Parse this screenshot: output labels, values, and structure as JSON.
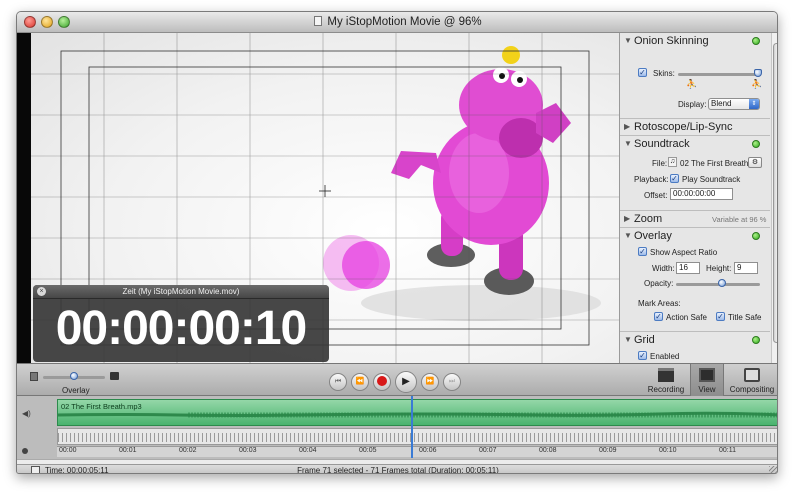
{
  "window": {
    "title": "My iStopMotion Movie @ 96%"
  },
  "sidebar": {
    "onion_skinning": {
      "title": "Onion Skinning",
      "skins_label": "Skins:",
      "display_label": "Display:",
      "display_value": "Blend"
    },
    "rotoscope": {
      "title": "Rotoscope/Lip-Sync"
    },
    "soundtrack": {
      "title": "Soundtrack",
      "file_label": "File:",
      "file_value": "02 The First Breath...",
      "playback_label": "Playback:",
      "play_soundtrack": "Play Soundtrack",
      "offset_label": "Offset:",
      "offset_value": "00:00:00:00"
    },
    "zoom": {
      "title": "Zoom",
      "value": "Variable at 96 %"
    },
    "overlay": {
      "title": "Overlay",
      "show_aspect_ratio": "Show Aspect Ratio",
      "width_label": "Width:",
      "width_value": "16",
      "height_label": "Height:",
      "height_value": "9",
      "opacity_label": "Opacity:",
      "opacity_level": 0.55,
      "mark_areas_label": "Mark Areas:",
      "action_safe": "Action Safe",
      "title_safe": "Title Safe"
    },
    "grid": {
      "title": "Grid",
      "enabled": "Enabled"
    }
  },
  "timer_panel": {
    "title": "Zeit (My iStopMotion Movie.mov)",
    "timecode": "00:00:00:10"
  },
  "toolbar": {
    "overlay_label": "Overlay",
    "overlay_level": 0.5,
    "modes": [
      {
        "label": "Recording",
        "icon": "clapperboard-icon"
      },
      {
        "label": "View",
        "icon": "view-icon"
      },
      {
        "label": "Compositing",
        "icon": "layers-icon"
      }
    ]
  },
  "timeline": {
    "audio_track": "02 The First Breath.mp3",
    "ruler": [
      "00:00",
      "00:01",
      "00:02",
      "00:03",
      "00:04",
      "00:05",
      "00:06",
      "00:07",
      "00:08",
      "00:09",
      "00:10",
      "00:11"
    ],
    "playhead_fraction": 0.49
  },
  "status": {
    "time": "Time: 00:00:05:11",
    "selection": "Frame 71 selected - 71 Frames total (Duration: 00:05:11)"
  },
  "colors": {
    "accent_blue": "#3a7bd5",
    "record_red": "#d81818",
    "audio_green": "#52b879",
    "enabled_green": "#35b22a"
  }
}
